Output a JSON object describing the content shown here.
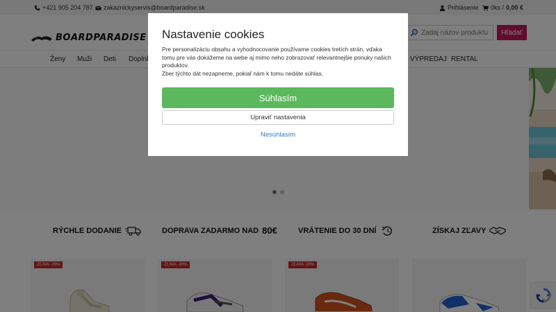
{
  "topbar": {
    "phone": "+421 905 204 787",
    "email": "zakaznickyservis@boardparadise.sk",
    "login": "Prihlásenie",
    "cart_count": "0ks / ",
    "cart_total": "0,00 €"
  },
  "header": {
    "logo_text": "BOARDPARADISE",
    "search_placeholder": "Zadaj názov produktu",
    "search_button": "Hľadať"
  },
  "nav": {
    "items": [
      "Ženy",
      "Muži",
      "Deti",
      "Doplnk",
      "VÝPREDAJ",
      "RENTAL"
    ]
  },
  "usp": {
    "items": [
      {
        "text": "RÝCHLE DODANIE",
        "icon": "truck-icon"
      },
      {
        "text": "DOPRAVA ZADARMO NAD",
        "amount": "80€",
        "icon": ""
      },
      {
        "text": "VRÁTENIE DO 30 DNÍ",
        "icon": "return-icon"
      },
      {
        "text": "ZÍSKAJ ZĽAVY",
        "icon": "handshake-icon"
      }
    ]
  },
  "products": [
    {
      "badge": "ZĽAVA -20%"
    },
    {
      "badge": "ZĽAVA -20%"
    },
    {
      "badge": "ZĽAVA -20%"
    },
    {
      "badge": ""
    }
  ],
  "cookie_modal": {
    "title": "Nastavenie cookies",
    "description": "Pre personalizáciu obsahu a vyhodnocovanie používame cookies tretích strán, vďaka tomu pre vás dokážeme na webe aj mimo neho zobrazovať relevantnejšie ponuky našich produktov.",
    "note": "Zber týchto dát nezapneme, pokiaľ nám k tomu nedáte súhlas.",
    "accept": "Súhlasím",
    "settings": "Upraviť nastavenia",
    "decline": "Nesúhlasím"
  },
  "colors": {
    "accept": "#5cb85c",
    "search_button": "#c2185b",
    "badge": "#c62828",
    "link": "#337ab7"
  }
}
